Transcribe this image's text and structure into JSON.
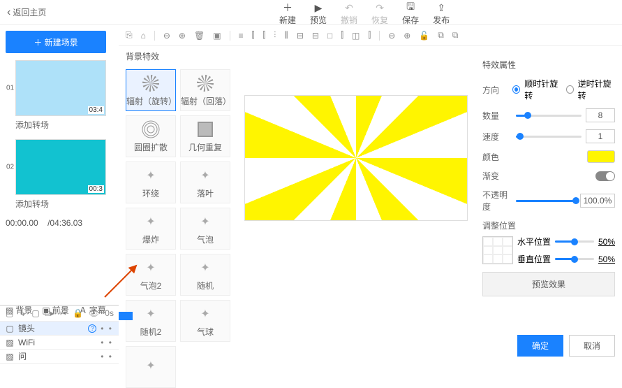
{
  "top": {
    "back": "返回主页",
    "actions": [
      {
        "icon": "＋",
        "label": "新建"
      },
      {
        "icon": "▶",
        "label": "预览"
      },
      {
        "icon": "↶",
        "label": "撤销",
        "disabled": true
      },
      {
        "icon": "↷",
        "label": "恢复",
        "disabled": true
      },
      {
        "icon": "🖫",
        "label": "保存"
      },
      {
        "icon": "⇪",
        "label": "发布"
      }
    ]
  },
  "left": {
    "add_scene": "＋ 新建场景",
    "scenes": [
      {
        "num": "01",
        "time": "03:4",
        "trans": "添加转场",
        "has_content": true
      },
      {
        "num": "02",
        "time": "00:3",
        "trans": "添加转场",
        "has_content": false
      }
    ],
    "cur_time": "00:00.00",
    "total_time": "/04:36.03",
    "tabs": [
      {
        "icon": "▨",
        "label": "背景"
      },
      {
        "icon": "▣",
        "label": "前景"
      },
      {
        "icon": "Ａ",
        "label": "字幕"
      }
    ],
    "track_tools": [
      "▢",
      "↳",
      "▢",
      "□▸",
      "↦",
      "🔒",
      "👁"
    ],
    "track_time": "0s",
    "tracks": [
      {
        "icon": "▢",
        "name": "镜头",
        "help": true,
        "sel": true
      },
      {
        "icon": "▨",
        "name": "WiFi",
        "help": false,
        "sel": false
      },
      {
        "icon": "▨",
        "name": "问",
        "help": false,
        "sel": false
      }
    ]
  },
  "toolbar_icons": [
    "⎘",
    "⌂",
    "",
    "⊖",
    "⊕",
    "🗑",
    "▣",
    "",
    "≡",
    "⫿",
    "⫿",
    "⫶",
    "⫼",
    "⊟",
    "⊟",
    "□",
    "⫿",
    "◫",
    "⫿",
    "",
    "⊖",
    "⊕",
    "🔓",
    "⧉",
    "⧉"
  ],
  "fx": {
    "title": "背景特效",
    "items": [
      {
        "icon": "radiate",
        "label": "辐射（旋转）",
        "sel": true
      },
      {
        "icon": "radiate2",
        "label": "辐射（回落）"
      },
      {
        "icon": "circles",
        "label": "圆圈扩散"
      },
      {
        "icon": "grid",
        "label": "几何重复"
      },
      {
        "icon": "orbit",
        "label": "环绕"
      },
      {
        "icon": "leaf",
        "label": "落叶"
      },
      {
        "icon": "burst",
        "label": "爆炸"
      },
      {
        "icon": "bubble",
        "label": "气泡"
      },
      {
        "icon": "bubble",
        "label": "气泡2"
      },
      {
        "icon": "random",
        "label": "随机"
      },
      {
        "icon": "star",
        "label": "随机2"
      },
      {
        "icon": "balloon",
        "label": "气球"
      },
      {
        "icon": "spark",
        "label": ""
      }
    ]
  },
  "props": {
    "title": "特效属性",
    "direction": {
      "label": "方向",
      "opt1": "顺时针旋转",
      "opt2": "逆时针旋转"
    },
    "count": {
      "label": "数量",
      "value": "8",
      "fill": 18
    },
    "speed": {
      "label": "速度",
      "value": "1",
      "fill": 6
    },
    "color": {
      "label": "颜色",
      "hex": "#fff500"
    },
    "gradient": {
      "label": "渐变"
    },
    "opacity": {
      "label": "不透明度",
      "value": "100.0%",
      "fill": 100
    },
    "position": {
      "label": "调整位置",
      "h": "水平位置",
      "h_val": "50%",
      "v": "垂直位置",
      "v_val": "50%"
    },
    "preview": "预览效果"
  },
  "buttons": {
    "ok": "确定",
    "cancel": "取消"
  }
}
